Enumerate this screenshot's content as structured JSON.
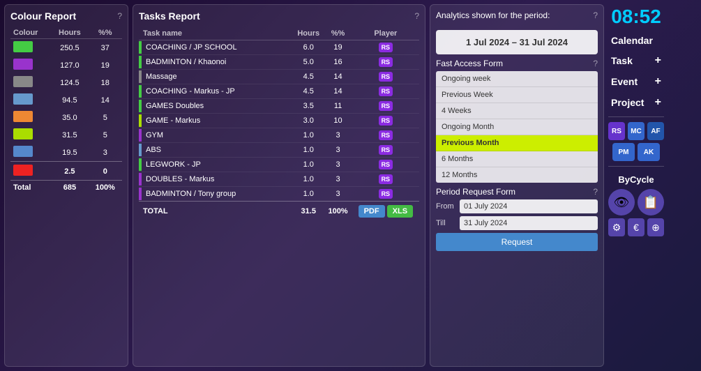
{
  "colourReport": {
    "title": "Colour Report",
    "helpIcon": "?",
    "headers": [
      "Colour",
      "Hours",
      "%%"
    ],
    "rows": [
      {
        "color": "#44cc44",
        "hours": "250.5",
        "percent": "37"
      },
      {
        "color": "#9933cc",
        "hours": "127.0",
        "percent": "19"
      },
      {
        "color": "#888888",
        "hours": "124.5",
        "percent": "18"
      },
      {
        "color": "#6699cc",
        "hours": "94.5",
        "percent": "14"
      },
      {
        "color": "#ee8833",
        "hours": "35.0",
        "percent": "5"
      },
      {
        "color": "#aadd00",
        "hours": "31.5",
        "percent": "5"
      },
      {
        "color": "#5588cc",
        "hours": "19.5",
        "percent": "3"
      },
      {
        "color": "#ee2222",
        "hours": "2.5",
        "percent": "0"
      }
    ],
    "totalLabel": "Total",
    "totalHours": "685",
    "totalPercent": "100%"
  },
  "tasksReport": {
    "title": "Tasks Report",
    "helpIcon": "?",
    "headers": [
      "Task name",
      "Hours",
      "%%",
      "Player"
    ],
    "rows": [
      {
        "color": "#44cc44",
        "name": "COACHING / JP SCHOOL",
        "hours": "6.0",
        "percent": "19",
        "player": "RS"
      },
      {
        "color": "#44cc44",
        "name": "BADMINTON / Khaonoi",
        "hours": "5.0",
        "percent": "16",
        "player": "RS"
      },
      {
        "color": "#888888",
        "name": "Massage",
        "hours": "4.5",
        "percent": "14",
        "player": "RS"
      },
      {
        "color": "#44cc44",
        "name": "COACHING - Markus - JP",
        "hours": "4.5",
        "percent": "14",
        "player": "RS"
      },
      {
        "color": "#44cc44",
        "name": "GAMES Doubles",
        "hours": "3.5",
        "percent": "11",
        "player": "RS"
      },
      {
        "color": "#aadd00",
        "name": "GAME - Markus",
        "hours": "3.0",
        "percent": "10",
        "player": "RS"
      },
      {
        "color": "#9933cc",
        "name": "GYM",
        "hours": "1.0",
        "percent": "3",
        "player": "RS"
      },
      {
        "color": "#6699cc",
        "name": "ABS",
        "hours": "1.0",
        "percent": "3",
        "player": "RS"
      },
      {
        "color": "#44cc44",
        "name": "LEGWORK - JP",
        "hours": "1.0",
        "percent": "3",
        "player": "RS"
      },
      {
        "color": "#9933cc",
        "name": "DOUBLES - Markus",
        "hours": "1.0",
        "percent": "3",
        "player": "RS"
      },
      {
        "color": "#9933cc",
        "name": "BADMINTON / Tony group",
        "hours": "1.0",
        "percent": "3",
        "player": "RS"
      }
    ],
    "totalLabel": "TOTAL",
    "totalHours": "31.5",
    "totalPercent": "100%",
    "pdfLabel": "PDF",
    "xlsLabel": "XLS"
  },
  "analytics": {
    "title": "Analytics shown for the period:",
    "helpIcon": "?",
    "period": "1 Jul 2024 – 31 Jul 2024",
    "fastAccessTitle": "Fast Access Form",
    "fastHelpIcon": "?",
    "fastItems": [
      {
        "label": "Ongoing week",
        "active": false
      },
      {
        "label": "Previous Week",
        "active": false
      },
      {
        "label": "4 Weeks",
        "active": false
      },
      {
        "label": "Ongoing Month",
        "active": false
      },
      {
        "label": "Previous Month",
        "active": true
      },
      {
        "label": "6 Months",
        "active": false
      },
      {
        "label": "12 Months",
        "active": false
      }
    ],
    "periodRequestTitle": "Period Request Form",
    "periodHelpIcon": "?",
    "fromLabel": "From",
    "tillLabel": "Till",
    "fromValue": "01 July 2024",
    "tillValue": "31 July 2024",
    "requestLabel": "Request"
  },
  "rightPanel": {
    "clock": "08:52",
    "calendarLabel": "Calendar",
    "taskLabel": "Task",
    "eventLabel": "Event",
    "projectLabel": "Project",
    "plusIcon": "+",
    "buttons": [
      {
        "label": "RS",
        "color": "#6633cc"
      },
      {
        "label": "MC",
        "color": "#3366cc"
      },
      {
        "label": "AF",
        "color": "#2255aa"
      }
    ],
    "buttons2": [
      {
        "label": "PM",
        "color": "#3366cc"
      },
      {
        "label": "AK",
        "color": "#3366cc"
      }
    ],
    "bycycleLabel": "ByCycle",
    "iconBtns": [
      {
        "icon": "👁",
        "color": "#5544aa"
      },
      {
        "icon": "📋",
        "color": "#5544aa"
      }
    ],
    "smallIconBtns": [
      {
        "icon": "⚙",
        "color": "#5544aa"
      },
      {
        "icon": "€",
        "color": "#5544aa"
      },
      {
        "icon": "⊕",
        "color": "#5544aa"
      }
    ]
  }
}
